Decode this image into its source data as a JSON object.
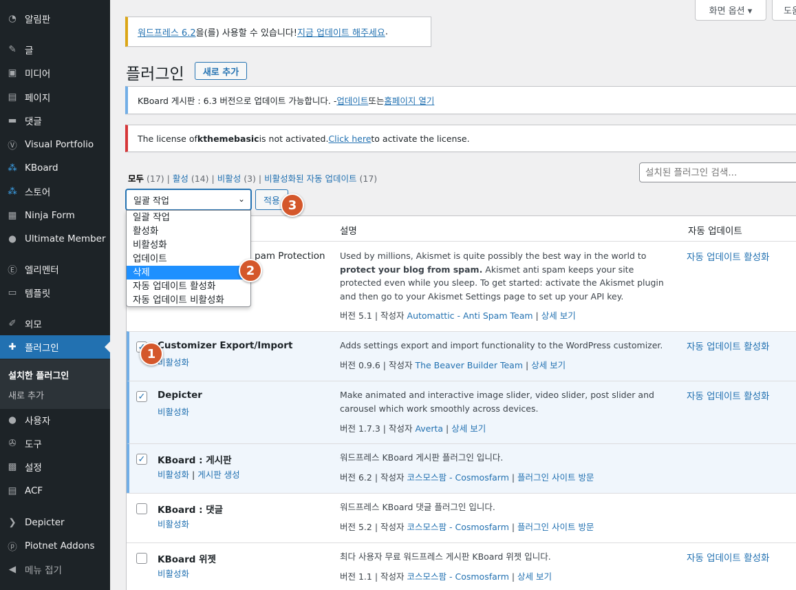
{
  "sidebar": {
    "items": [
      {
        "label": "알림판",
        "icon": "dashboard-icon"
      },
      {
        "label": "글",
        "icon": "pin-icon"
      },
      {
        "label": "미디어",
        "icon": "media-icon"
      },
      {
        "label": "페이지",
        "icon": "page-icon"
      },
      {
        "label": "댓글",
        "icon": "comment-icon"
      },
      {
        "label": "Visual Portfolio",
        "icon": "visual-portfolio-icon"
      },
      {
        "label": "KBoard",
        "icon": "kboard-icon"
      },
      {
        "label": "스토어",
        "icon": "store-icon"
      },
      {
        "label": "Ninja Form",
        "icon": "form-icon"
      },
      {
        "label": "Ultimate Member",
        "icon": "user-icon"
      },
      {
        "label": "엘리멘터",
        "icon": "elementor-icon"
      },
      {
        "label": "템플릿",
        "icon": "folder-icon"
      },
      {
        "label": "외모",
        "icon": "brush-icon"
      },
      {
        "label": "플러그인",
        "icon": "plugin-icon"
      },
      {
        "label": "사용자",
        "icon": "users-icon"
      },
      {
        "label": "도구",
        "icon": "wrench-icon"
      },
      {
        "label": "설정",
        "icon": "settings-icon"
      },
      {
        "label": "ACF",
        "icon": "acf-icon"
      },
      {
        "label": "Depicter",
        "icon": "depicter-icon"
      },
      {
        "label": "Piotnet Addons",
        "icon": "piotnet-icon"
      },
      {
        "label": "메뉴 접기",
        "icon": "collapse-icon"
      }
    ],
    "submenu": {
      "installed": "설치한 플러그인",
      "add_new": "새로 추가"
    }
  },
  "top": {
    "screen_options": "화면 옵션 ▾",
    "help": "도움"
  },
  "notices": {
    "update_link": "워드프레스 6.2",
    "update_mid": "을(를) 사용할 수 있습니다! ",
    "update_now": "지금 업데이트 해주세요",
    "update_end": ".",
    "kboard_text": "KBoard 게시판 : 6.3 버전으로 업데이트 가능합니다. - ",
    "kboard_update": "업데이트",
    "kboard_or": " 또는 ",
    "kboard_home": "홈페이지 열기",
    "license_pre": "The license of ",
    "license_name": "kthemebasic",
    "license_mid": " is not activated. ",
    "license_link": "Click here",
    "license_end": " to activate the license."
  },
  "page": {
    "title": "플러그인",
    "add_new": "새로 추가"
  },
  "filters": {
    "all": "모두",
    "all_count": "(17)",
    "active": "활성",
    "active_count": "(14)",
    "inactive": "비활성",
    "inactive_count": "(3)",
    "autoupdate_disabled": "비활성화된 자동 업데이트",
    "autoupdate_count": "(17)"
  },
  "search": {
    "placeholder": "설치된 플러그인 검색..."
  },
  "bulk": {
    "selected": "일괄 작업",
    "apply": "적용",
    "options": [
      "일괄 작업",
      "활성화",
      "비활성화",
      "업데이트",
      "삭제",
      "자동 업데이트 활성화",
      "자동 업데이트 비활성화"
    ]
  },
  "table": {
    "col_desc": "설명",
    "col_auto": "자동 업데이트",
    "plugins": [
      {
        "name": "pam Protection",
        "action": "",
        "desc": "Used by millions, Akismet is quite possibly the best way in the world to ",
        "desc_bold": "protect your blog from spam.",
        "desc_rest": " Akismet anti spam keeps your site protected even while you sleep. To get started: activate the Akismet plugin and then go to your Akismet Settings page to set up your API key.",
        "version": "버전 5.1",
        "by": "작성자",
        "author": "Automattic - Anti Spam Team",
        "details": "상세 보기",
        "auto": "자동 업데이트 활성화"
      },
      {
        "name": "Customizer Export/Import",
        "action": "비활성화",
        "desc": "Adds settings export and import functionality to the WordPress customizer.",
        "version": "버전 0.9.6",
        "by": "작성자",
        "author": "The Beaver Builder Team",
        "details": "상세 보기",
        "auto": "자동 업데이트 활성화"
      },
      {
        "name": "Depicter",
        "action": "비활성화",
        "desc": "Make animated and interactive image slider, video slider, post slider and carousel which work smoothly across devices.",
        "version": "버전 1.7.3",
        "by": "작성자",
        "author": "Averta",
        "details": "상세 보기",
        "auto": "자동 업데이트 활성화"
      },
      {
        "name": "KBoard : 게시판",
        "action": "비활성화",
        "action2": "게시판 생성",
        "desc": "워드프레스 KBoard 게시판 플러그인 입니다.",
        "version": "버전 6.2",
        "by": "작성자",
        "author": "코스모스팜 - Cosmosfarm",
        "details": "플러그인 사이트 방문",
        "auto": ""
      },
      {
        "name": "KBoard : 댓글",
        "action": "비활성화",
        "desc": "워드프레스 KBoard 댓글 플러그인 입니다.",
        "version": "버전 5.2",
        "by": "작성자",
        "author": "코스모스팜 - Cosmosfarm",
        "details": "플러그인 사이트 방문",
        "auto": ""
      },
      {
        "name": "KBoard 위젯",
        "action": "비활성화",
        "desc": "최다 사용자 무료 워드프레스 게시판 KBoard 위젯 입니다.",
        "version": "버전 1.1",
        "by": "작성자",
        "author": "코스모스팜 - Cosmosfarm",
        "details": "상세 보기",
        "auto": "자동 업데이트 활성화"
      }
    ]
  },
  "badges": [
    "1",
    "2",
    "3"
  ],
  "colors": {
    "sidebar_bg": "#1d2327",
    "accent": "#2271b1",
    "badge": "#d4572b",
    "highlight": "#1e90ff"
  }
}
